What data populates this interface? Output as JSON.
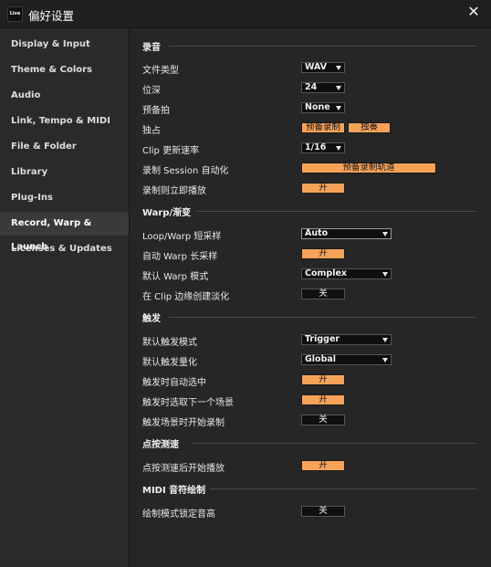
{
  "window": {
    "app_badge": "Live",
    "title": "偏好设置",
    "close_symbol": "✕"
  },
  "sidebar": {
    "items": [
      {
        "label": "Display & Input"
      },
      {
        "label": "Theme & Colors"
      },
      {
        "label": "Audio"
      },
      {
        "label": "Link, Tempo & MIDI"
      },
      {
        "label": "File & Folder"
      },
      {
        "label": "Library"
      },
      {
        "label": "Plug-Ins"
      },
      {
        "label": "Record, Warp & Launch"
      },
      {
        "label": "Licenses & Updates"
      }
    ],
    "selected": "Record, Warp & Launch"
  },
  "record": {
    "title": "录音",
    "file_type": {
      "label": "文件类型",
      "value": "WAV"
    },
    "bit_depth": {
      "label": "位深",
      "value": "24"
    },
    "count_in": {
      "label": "预备拍",
      "value": "None"
    },
    "exclusive": {
      "label": "独占",
      "arm": "预备录制",
      "solo": "独奏"
    },
    "clip_update": {
      "label": "Clip 更新速率",
      "value": "1/16"
    },
    "session_auto": {
      "label": "录制 Session 自动化",
      "value": "预备录制轨道"
    },
    "start_playback": {
      "label": "录制则立即播放",
      "value": "开"
    }
  },
  "warp": {
    "title": "Warp/渐变",
    "loop_short": {
      "label": "Loop/Warp 短采样",
      "value": "Auto"
    },
    "auto_long": {
      "label": "自动 Warp 长采样",
      "value": "开"
    },
    "default_mode": {
      "label": "默认 Warp 模式",
      "value": "Complex"
    },
    "edge_fades": {
      "label": "在 Clip 边缘创建淡化",
      "value": "关"
    }
  },
  "launch": {
    "title": "触发",
    "default_mode": {
      "label": "默认触发模式",
      "value": "Trigger"
    },
    "default_quant": {
      "label": "默认触发量化",
      "value": "Global"
    },
    "auto_select": {
      "label": "触发时自动选中",
      "value": "开"
    },
    "next_scene": {
      "label": "触发时选取下一个场景",
      "value": "开"
    },
    "scene_record": {
      "label": "触发场景时开始录制",
      "value": "关"
    }
  },
  "tap": {
    "title": "点按测速",
    "start_play": {
      "label": "点按测速后开始播放",
      "value": "开"
    }
  },
  "midi": {
    "title": "MIDI 音符绘制",
    "lock_pitch": {
      "label": "绘制模式锁定音高",
      "value": "关"
    }
  },
  "colors": {
    "accent": "#f6a259",
    "background": "#262626",
    "sidebar": "#2a2a2a",
    "selected": "#3a3a3a"
  }
}
